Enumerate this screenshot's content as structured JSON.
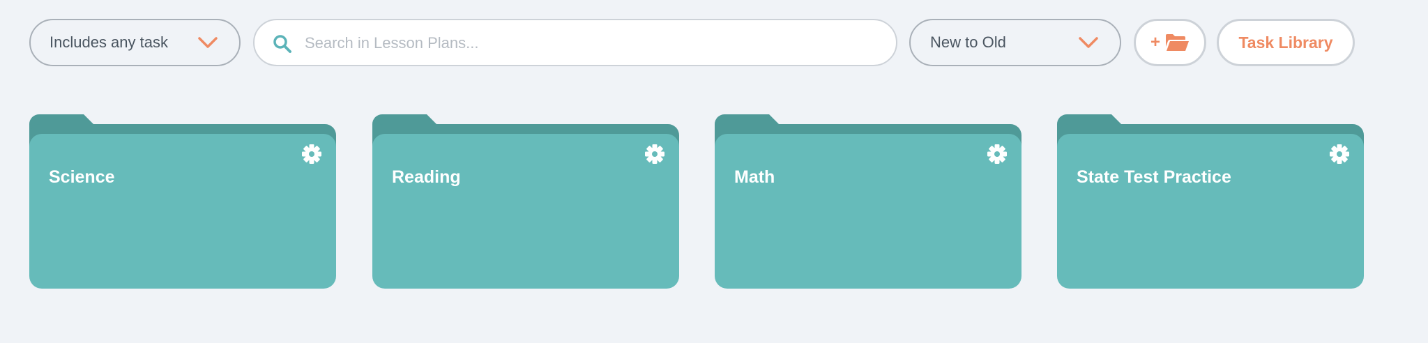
{
  "toolbar": {
    "filter": {
      "selected": "Includes any task",
      "icon": "chevron-down-icon"
    },
    "search": {
      "placeholder": "Search in Lesson Plans...",
      "value": "",
      "icon": "search-icon"
    },
    "sort": {
      "selected": "New to Old",
      "icon": "chevron-down-icon"
    },
    "new_folder": {
      "plus": "+",
      "icon": "folder-open-icon"
    },
    "task_library_label": "Task Library"
  },
  "folders": [
    {
      "title": "Science",
      "settings_icon": "gear-icon"
    },
    {
      "title": "Reading",
      "settings_icon": "gear-icon"
    },
    {
      "title": "Math",
      "settings_icon": "gear-icon"
    },
    {
      "title": "State Test Practice",
      "settings_icon": "gear-icon"
    }
  ],
  "colors": {
    "background": "#f0f3f7",
    "accent": "#ef8a62",
    "folder_front": "#66bbba",
    "folder_back": "#4f9a98",
    "search_icon": "#5bb3b8"
  }
}
